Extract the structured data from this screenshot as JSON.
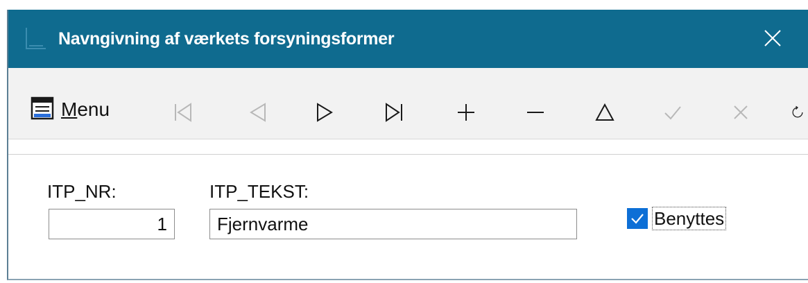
{
  "window": {
    "title": "Navngivning af værkets forsyningsformer",
    "title_bar_color": "#0f6b8f",
    "app_icon": "window-app-icon",
    "close_icon": "close-icon"
  },
  "toolbar": {
    "menu_label_underlined": "M",
    "menu_label_rest": "enu",
    "menu_icon": "menu-list-icon",
    "tools": [
      {
        "name": "first-record-icon",
        "enabled": false
      },
      {
        "name": "previous-record-icon",
        "enabled": false
      },
      {
        "name": "next-record-icon",
        "enabled": true
      },
      {
        "name": "last-record-icon",
        "enabled": true
      },
      {
        "name": "add-record-icon",
        "enabled": true
      },
      {
        "name": "delete-record-icon",
        "enabled": true
      },
      {
        "name": "edit-record-icon",
        "enabled": true
      },
      {
        "name": "confirm-icon",
        "enabled": false
      },
      {
        "name": "cancel-icon",
        "enabled": false
      },
      {
        "name": "refresh-icon",
        "enabled": true
      }
    ]
  },
  "form": {
    "itp_nr_label": "ITP_NR:",
    "itp_nr_value": "1",
    "itp_tekst_label": "ITP_TEKST:",
    "itp_tekst_value": "Fjernvarme",
    "benyttes_label": "Benyttes",
    "benyttes_checked": true,
    "checkbox_color": "#0d6fd6"
  }
}
